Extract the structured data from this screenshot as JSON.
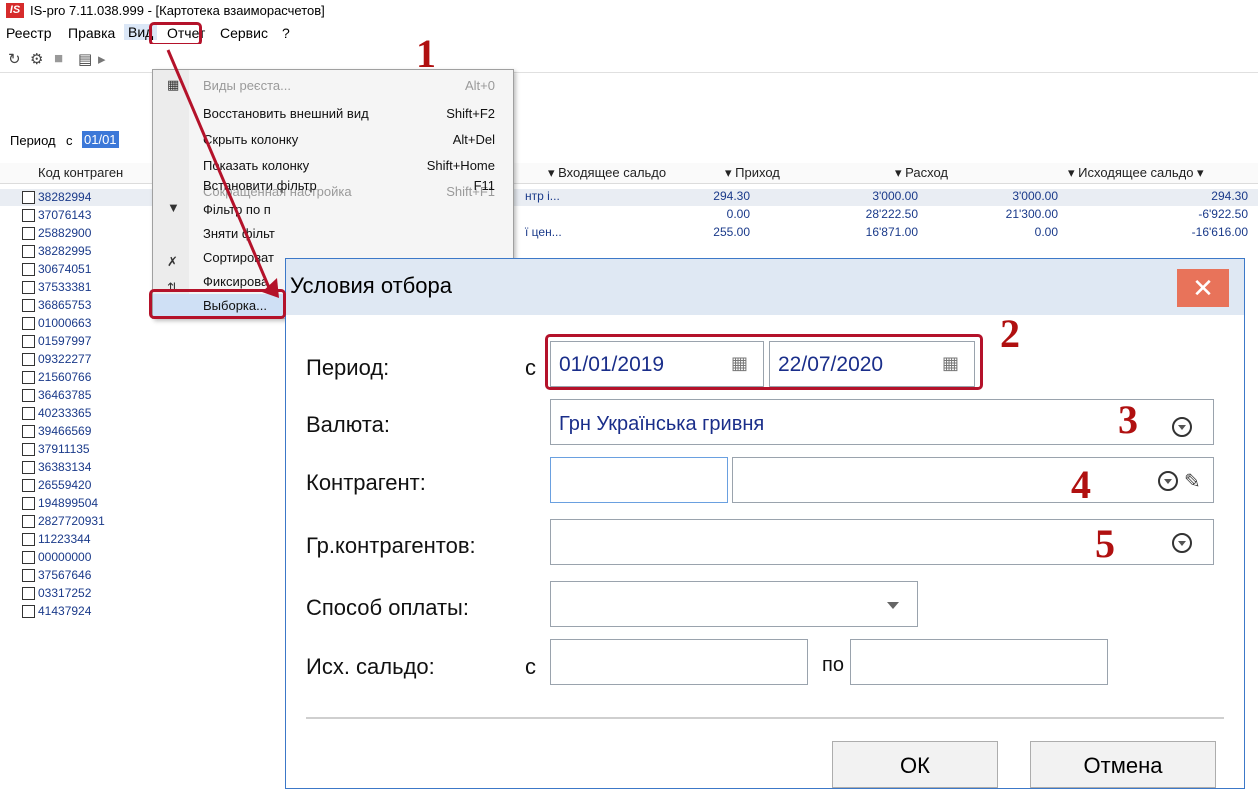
{
  "window": {
    "logo": "IS",
    "title": "IS-pro 7.11.038.999 - [Картотека взаиморасчетов]"
  },
  "menubar": [
    "Реестр",
    "Правка",
    "Вид",
    "Отчет",
    "Сервис",
    "?"
  ],
  "period_bar": {
    "label": "Период",
    "from": "с",
    "from_value": "01/01"
  },
  "grid": {
    "columns": [
      "Код контраген",
      "Входящее сальдо",
      "Приход",
      "Расход",
      "Исходящее сальдо"
    ],
    "rows": [
      {
        "code": "38282994",
        "partial": "нтр і...",
        "in": "294.30",
        "income": "3'000.00",
        "expense": "3'000.00",
        "out": "294.30"
      },
      {
        "code": "37076143",
        "partial": "",
        "in": "0.00",
        "income": "28'222.50",
        "expense": "21'300.00",
        "out": "-6'922.50"
      },
      {
        "code": "25882900",
        "partial": "ї цен...",
        "in": "255.00",
        "income": "16'871.00",
        "expense": "0.00",
        "out": "-16'616.00"
      },
      {
        "code": "38282995"
      },
      {
        "code": "30674051"
      },
      {
        "code": "37533381"
      },
      {
        "code": "36865753"
      },
      {
        "code": "01000663"
      },
      {
        "code": "01597997"
      },
      {
        "code": "09322277"
      },
      {
        "code": "21560766"
      },
      {
        "code": "36463785"
      },
      {
        "code": "40233365"
      },
      {
        "code": "39466569"
      },
      {
        "code": "37911135"
      },
      {
        "code": "36383134"
      },
      {
        "code": "26559420"
      },
      {
        "code": "194899504"
      },
      {
        "code": "2827720931"
      },
      {
        "code": "11223344"
      },
      {
        "code": "00000000"
      },
      {
        "code": "37567646"
      },
      {
        "code": "03317252"
      },
      {
        "code": "41437924"
      }
    ]
  },
  "context_menu": {
    "items": [
      {
        "label": "Виды реєста...",
        "shortcut": "Alt+0",
        "disabled": true
      },
      {
        "label": "Восстановить внешний вид",
        "shortcut": "Shift+F2",
        "disabled": false
      },
      {
        "label": "Скрыть колонку",
        "shortcut": "Alt+Del",
        "disabled": false
      },
      {
        "label": "Показать колонку",
        "shortcut": "Shift+Home",
        "disabled": false
      },
      {
        "label": "Сокращенная настройка",
        "shortcut": "Shift+F1",
        "disabled": true
      },
      {
        "label": "Встановити фільтр",
        "shortcut": "F11",
        "disabled": false
      },
      {
        "label": "Фільтр по п",
        "shortcut": "",
        "disabled": false
      },
      {
        "label": "Зняти фільт",
        "shortcut": "",
        "disabled": false
      },
      {
        "label": "Сортироват",
        "shortcut": "",
        "disabled": false
      },
      {
        "label": "Фиксирова",
        "shortcut": "",
        "disabled": false
      },
      {
        "label": "Выборка...",
        "shortcut": "",
        "disabled": false
      }
    ]
  },
  "dialog": {
    "title": "Условия отбора",
    "period_label": "Период:",
    "period_from": "с",
    "date_from": "01/01/2019",
    "date_to": "22/07/2020",
    "currency_label": "Валюта:",
    "currency_value": "Грн Українська гривня",
    "contractor_label": "Контрагент:",
    "group_label": "Гр.контрагентов:",
    "payment_label": "Способ оплаты:",
    "balance_label": "Исх. сальдо:",
    "balance_from": "с",
    "balance_to": "по",
    "ok_label": "ОК",
    "cancel_label": "Отмена"
  },
  "annotations": [
    "1",
    "2",
    "3",
    "4",
    "5"
  ],
  "colors": {
    "accent_red": "#b4122a",
    "link_blue": "#1a2e8a",
    "dialog_header": "#dfe8f3",
    "close_button": "#e8735a"
  }
}
